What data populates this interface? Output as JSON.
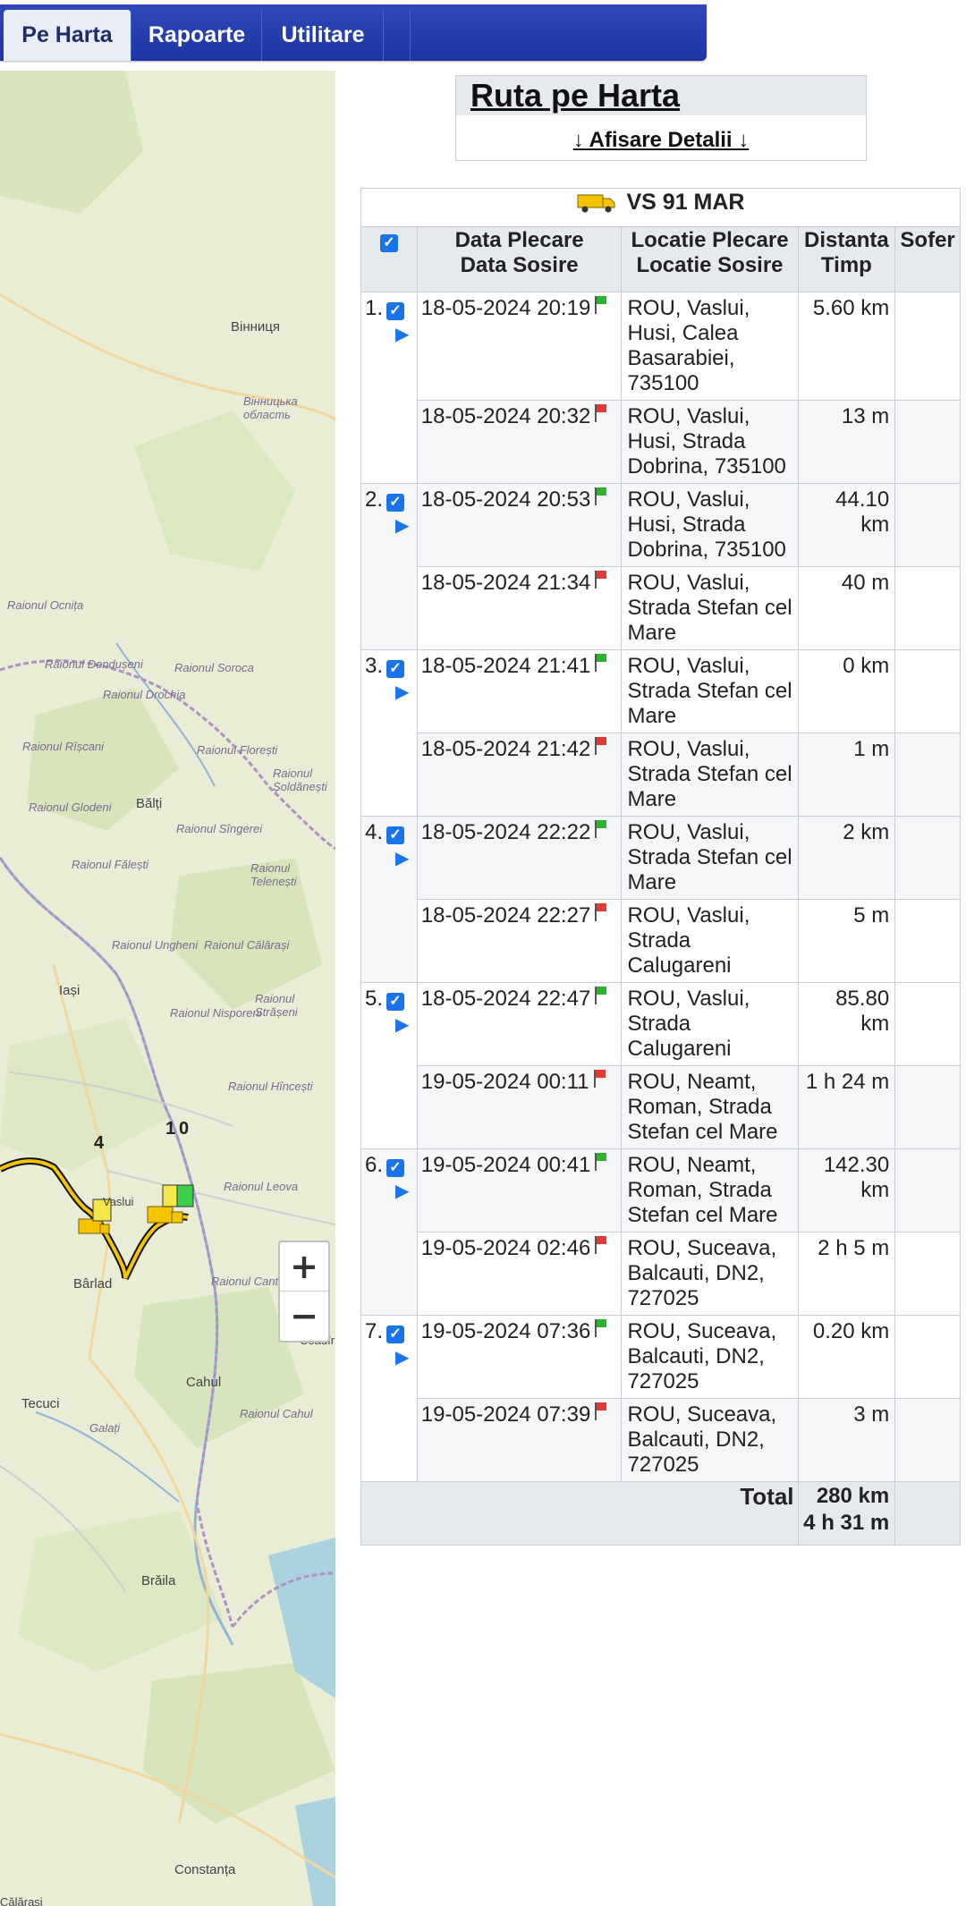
{
  "nav": {
    "tabs": [
      "Pe Harta",
      "Rapoarte",
      "Utilitare"
    ]
  },
  "header": {
    "title": "Ruta pe Harta",
    "details_link": "↓ Afisare Detalii ↓"
  },
  "vehicle": {
    "plate": "VS 91 MAR"
  },
  "table": {
    "columns": {
      "date_line1": "Data Plecare",
      "date_line2": "Data Sosire",
      "loc_line1": "Locatie Plecare",
      "loc_line2": "Locatie Sosire",
      "dist_line1": "Distanta",
      "dist_line2": "Timp",
      "driver": "Sofer"
    },
    "trips": [
      {
        "num": "1.",
        "dep_date": "18-05-2024 20:19",
        "dep_loc": "ROU, Vaslui, Husi, Calea Basarabiei, 735100",
        "dist": "5.60 km",
        "arr_date": "18-05-2024 20:32",
        "arr_loc": "ROU, Vaslui, Husi, Strada Dobrina, 735100",
        "time": "13 m"
      },
      {
        "num": "2.",
        "dep_date": "18-05-2024 20:53",
        "dep_loc": "ROU, Vaslui, Husi, Strada Dobrina, 735100",
        "dist": "44.10 km",
        "arr_date": "18-05-2024 21:34",
        "arr_loc": "ROU, Vaslui, Strada Stefan cel Mare",
        "time": "40 m"
      },
      {
        "num": "3.",
        "dep_date": "18-05-2024 21:41",
        "dep_loc": "ROU, Vaslui, Strada Stefan cel Mare",
        "dist": "0 km",
        "arr_date": "18-05-2024 21:42",
        "arr_loc": "ROU, Vaslui, Strada Stefan cel Mare",
        "time": "1 m"
      },
      {
        "num": "4.",
        "dep_date": "18-05-2024 22:22",
        "dep_loc": "ROU, Vaslui, Strada Stefan cel Mare",
        "dist": "2 km",
        "arr_date": "18-05-2024 22:27",
        "arr_loc": "ROU, Vaslui, Strada Calugareni",
        "time": "5 m"
      },
      {
        "num": "5.",
        "dep_date": "18-05-2024 22:47",
        "dep_loc": "ROU, Vaslui, Strada Calugareni",
        "dist": "85.80 km",
        "arr_date": "19-05-2024 00:11",
        "arr_loc": "ROU, Neamt, Roman, Strada Stefan cel Mare",
        "time": "1 h 24 m"
      },
      {
        "num": "6.",
        "dep_date": "19-05-2024 00:41",
        "dep_loc": "ROU, Neamt, Roman, Strada Stefan cel Mare",
        "dist": "142.30 km",
        "arr_date": "19-05-2024 02:46",
        "arr_loc": "ROU, Suceava, Balcauti, DN2, 727025",
        "time": "2 h 5 m"
      },
      {
        "num": "7.",
        "dep_date": "19-05-2024 07:36",
        "dep_loc": "ROU, Suceava, Balcauti, DN2, 727025",
        "dist": "0.20 km",
        "arr_date": "19-05-2024 07:39",
        "arr_loc": "ROU, Suceava, Balcauti, DN2, 727025",
        "time": "3 m"
      }
    ],
    "total_label": "Total",
    "total_dist": "280 km",
    "total_time": "4 h 31 m"
  },
  "map": {
    "zoom_in": "+",
    "zoom_out": "−",
    "markers": [
      "4",
      "1",
      "0"
    ],
    "labels": [
      "Вінниця",
      "Вінницька область",
      "Raionul Ocnița",
      "Raionul Dondușeni",
      "Raionul Soroca",
      "Raionul Drochia",
      "Raionul Rîșcani",
      "Raionul Florești",
      "Raionul Șoldănești",
      "Bălți",
      "Raionul Glodeni",
      "Raionul Sîngerei",
      "Raionul Fălești",
      "Raionul Telenești",
      "Raionul Ungheni",
      "Raionul Călărași",
      "Iași",
      "Raionul Strășeni",
      "Raionul Nisporeni",
      "Raionul Hîncești",
      "Raionul Leova",
      "Bârlad",
      "Raionul Cantemir",
      "Cahul",
      "Raionul Cahul",
      "Tecuci",
      "Galați",
      "Brăila",
      "Constanța",
      "Călărași",
      "Vaslui",
      "Ceadîr"
    ]
  },
  "colors": {
    "nav_bg": "#2f49b8",
    "accent": "#1a73e8",
    "flag_start": "#2bb32b",
    "flag_end": "#e53935",
    "route": "#f5c400"
  }
}
